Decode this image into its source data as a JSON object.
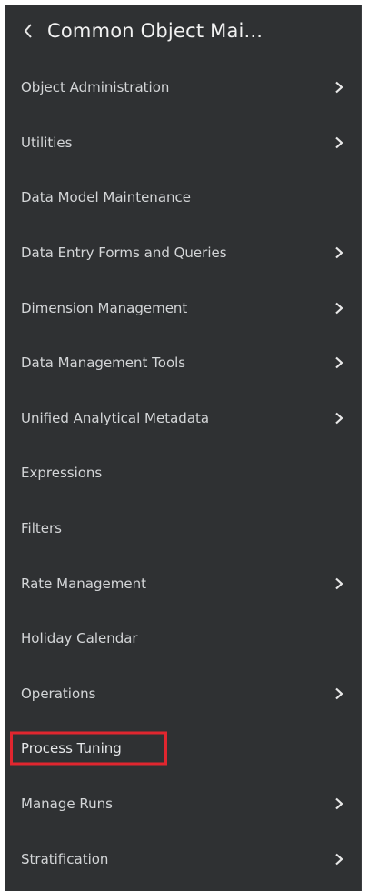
{
  "header": {
    "back_icon": "chevron-left-icon",
    "title": "Common Object Mai..."
  },
  "menu": {
    "items": [
      {
        "label": "Object Administration",
        "has_submenu": true
      },
      {
        "label": "Utilities",
        "has_submenu": true
      },
      {
        "label": "Data Model Maintenance",
        "has_submenu": false
      },
      {
        "label": "Data Entry Forms and Queries",
        "has_submenu": true
      },
      {
        "label": "Dimension Management",
        "has_submenu": true
      },
      {
        "label": "Data Management Tools",
        "has_submenu": true
      },
      {
        "label": "Unified Analytical Metadata",
        "has_submenu": true
      },
      {
        "label": "Expressions",
        "has_submenu": false
      },
      {
        "label": "Filters",
        "has_submenu": false
      },
      {
        "label": "Rate Management",
        "has_submenu": true
      },
      {
        "label": "Holiday Calendar",
        "has_submenu": false
      },
      {
        "label": "Operations",
        "has_submenu": true
      },
      {
        "label": "Process Tuning",
        "has_submenu": false,
        "highlighted": true
      },
      {
        "label": "Manage Runs",
        "has_submenu": true
      },
      {
        "label": "Stratification",
        "has_submenu": true
      }
    ]
  },
  "colors": {
    "panel_background": "#2f3133",
    "text": "#d4d6d8",
    "highlight_border": "#e0262f"
  }
}
